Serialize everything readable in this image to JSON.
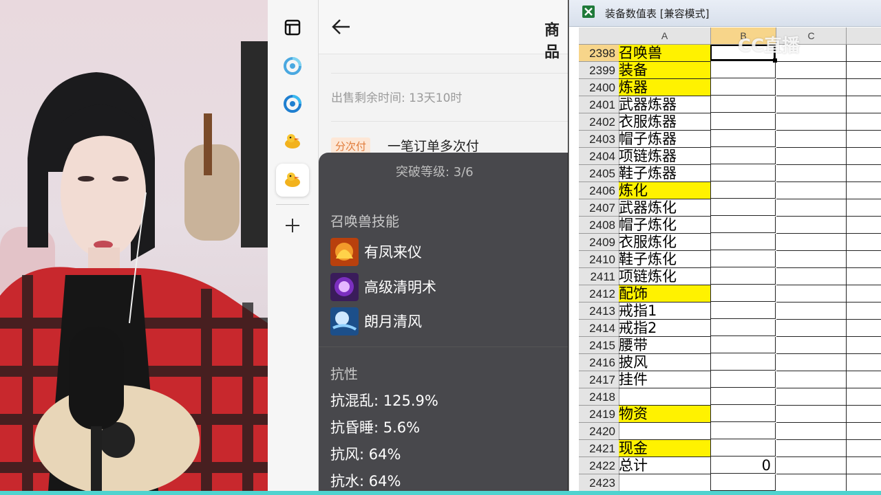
{
  "page": {
    "title": "商品",
    "sale_time": "出售剩余时间: 13天10时",
    "pay_tag": "分次付",
    "pay_text": "一笔订单多次付",
    "tooltip": {
      "level": "突破等级: 3/6",
      "skills_heading": "召唤兽技能",
      "skills": [
        {
          "name": "有凤来仪",
          "icon": "phoenix-skill-icon",
          "color": "#e8661b"
        },
        {
          "name": "高级清明术",
          "icon": "purple-orb-skill-icon",
          "color": "#9a3fd0"
        },
        {
          "name": "朗月清风",
          "icon": "moon-wind-skill-icon",
          "color": "#5ba3e0"
        }
      ],
      "resist_heading": "抗性",
      "resists": [
        "抗混乱: 125.9%",
        "抗昏睡: 5.6%",
        "抗风: 64%",
        "抗水: 64%"
      ]
    }
  },
  "sidebar": {
    "items": [
      {
        "icon": "tab-panel-icon"
      },
      {
        "icon": "cc-live-icon"
      },
      {
        "icon": "cc-live-icon"
      },
      {
        "icon": "duck-app-icon"
      },
      {
        "icon": "duck-app-icon",
        "active": true
      },
      {
        "icon": "plus-icon"
      }
    ]
  },
  "excel": {
    "title": "装备数值表 [兼容模式]",
    "columns": [
      "A",
      "B",
      "C"
    ],
    "rows": [
      {
        "num": "2398",
        "a": "召唤兽",
        "hl": true
      },
      {
        "num": "2399",
        "a": "装备",
        "hl": true
      },
      {
        "num": "2400",
        "a": "炼器",
        "hl": true
      },
      {
        "num": "2401",
        "a": "武器炼器"
      },
      {
        "num": "2402",
        "a": "衣服炼器"
      },
      {
        "num": "2403",
        "a": "帽子炼器"
      },
      {
        "num": "2404",
        "a": "项链炼器"
      },
      {
        "num": "2405",
        "a": "鞋子炼器"
      },
      {
        "num": "2406",
        "a": "炼化",
        "hl": true
      },
      {
        "num": "2407",
        "a": "武器炼化"
      },
      {
        "num": "2408",
        "a": "帽子炼化"
      },
      {
        "num": "2409",
        "a": "衣服炼化"
      },
      {
        "num": "2410",
        "a": "鞋子炼化"
      },
      {
        "num": "2411",
        "a": "项链炼化"
      },
      {
        "num": "2412",
        "a": "配饰",
        "hl": true
      },
      {
        "num": "2413",
        "a": "戒指1"
      },
      {
        "num": "2414",
        "a": "戒指2"
      },
      {
        "num": "2415",
        "a": "腰带"
      },
      {
        "num": "2416",
        "a": "披风"
      },
      {
        "num": "2417",
        "a": "挂件"
      },
      {
        "num": "2418",
        "a": ""
      },
      {
        "num": "2419",
        "a": "物资",
        "hl": true
      },
      {
        "num": "2420",
        "a": ""
      },
      {
        "num": "2421",
        "a": "现金",
        "hl": true
      },
      {
        "num": "2422",
        "a": "总计",
        "b": "0"
      },
      {
        "num": "2423",
        "a": ""
      }
    ]
  },
  "watermark": "CC直播",
  "colors": {
    "highlight": "#fff200",
    "accent_bar": "#4fd3cf",
    "selected_header": "#f7d58a"
  }
}
